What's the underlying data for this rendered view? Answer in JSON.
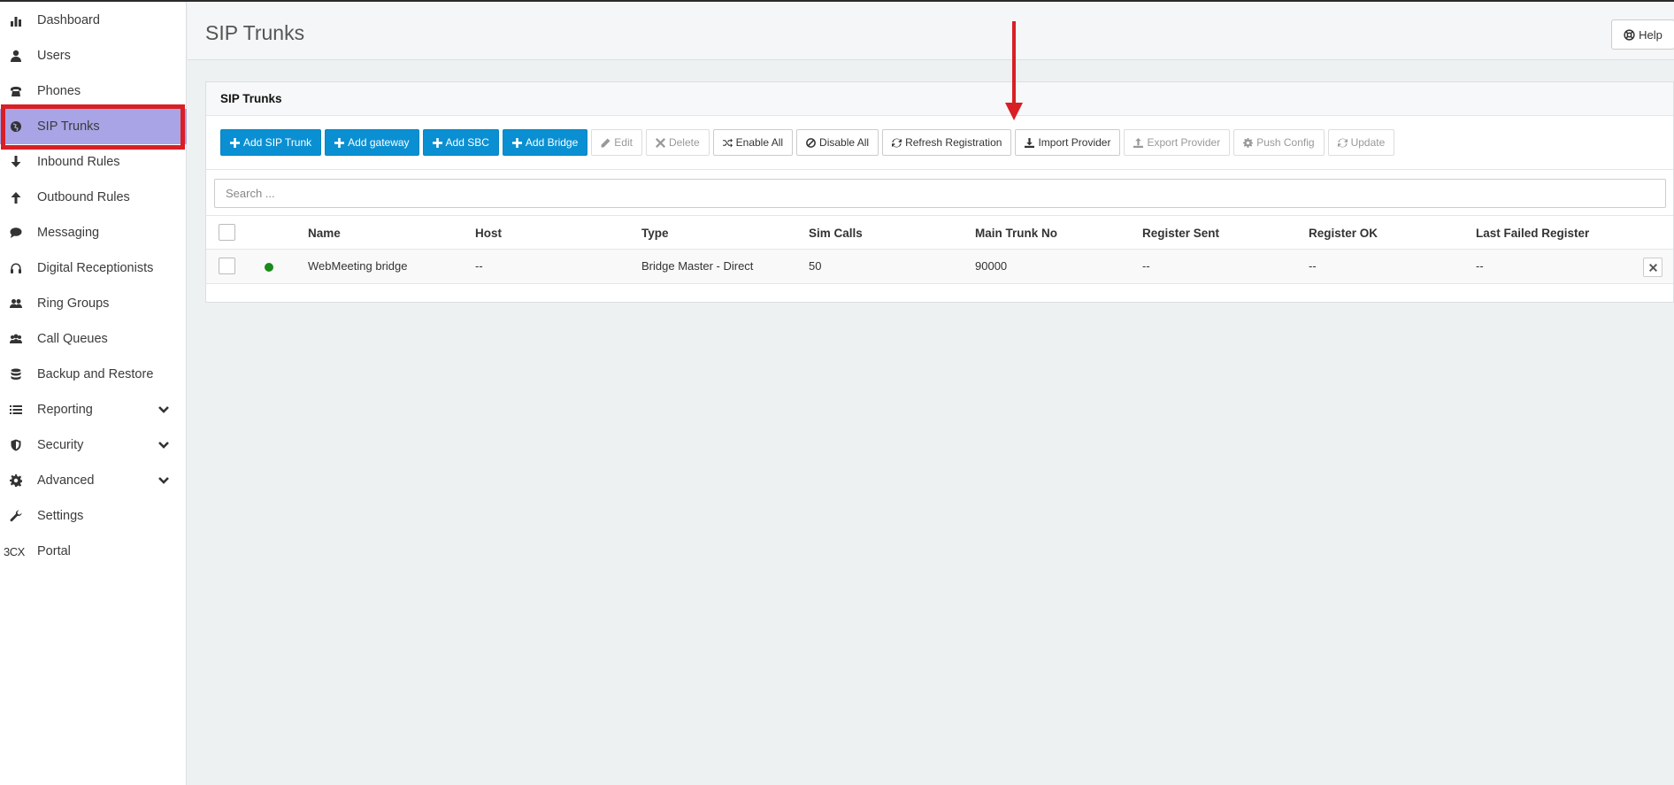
{
  "sidebar": {
    "items": [
      {
        "label": "Dashboard",
        "icon": "bar-chart-icon"
      },
      {
        "label": "Users",
        "icon": "user-icon"
      },
      {
        "label": "Phones",
        "icon": "phone-icon"
      },
      {
        "label": "SIP Trunks",
        "icon": "globe-icon",
        "active": true
      },
      {
        "label": "Inbound Rules",
        "icon": "arrow-down-icon"
      },
      {
        "label": "Outbound Rules",
        "icon": "arrow-up-icon"
      },
      {
        "label": "Messaging",
        "icon": "chat-bubble-icon"
      },
      {
        "label": "Digital Receptionists",
        "icon": "headset-icon"
      },
      {
        "label": "Ring Groups",
        "icon": "users-icon"
      },
      {
        "label": "Call Queues",
        "icon": "group-icon"
      },
      {
        "label": "Backup and Restore",
        "icon": "database-icon"
      },
      {
        "label": "Reporting",
        "icon": "list-icon",
        "expandable": true
      },
      {
        "label": "Security",
        "icon": "shield-icon",
        "expandable": true
      },
      {
        "label": "Advanced",
        "icon": "gear-icon",
        "expandable": true
      },
      {
        "label": "Settings",
        "icon": "wrench-icon"
      },
      {
        "label": "Portal",
        "icon": "3cx-logo",
        "logo_text": "3CX"
      }
    ]
  },
  "header": {
    "title": "SIP Trunks",
    "help_label": "Help"
  },
  "panel": {
    "title": "SIP Trunks",
    "toolbar": {
      "add_sip_trunk": "Add SIP Trunk",
      "add_gateway": "Add gateway",
      "add_sbc": "Add SBC",
      "add_bridge": "Add Bridge",
      "edit": "Edit",
      "delete": "Delete",
      "enable_all": "Enable All",
      "disable_all": "Disable All",
      "refresh_registration": "Refresh Registration",
      "import_provider": "Import Provider",
      "export_provider": "Export Provider",
      "push_config": "Push Config",
      "update": "Update"
    },
    "search": {
      "placeholder": "Search ...",
      "value": ""
    },
    "table": {
      "columns": [
        "Name",
        "Host",
        "Type",
        "Sim Calls",
        "Main Trunk No",
        "Register Sent",
        "Register OK",
        "Last Failed Register"
      ],
      "rows": [
        {
          "status_color": "#1a8a1a",
          "name": "WebMeeting bridge",
          "host": "--",
          "type": "Bridge Master - Direct",
          "sim_calls": "50",
          "main_trunk_no": "90000",
          "register_sent": "--",
          "register_ok": "--",
          "last_failed_register": "--"
        }
      ]
    }
  },
  "colors": {
    "primary": "#0a90d2",
    "active_nav": "#a8a4e6",
    "highlight_frame": "#d81f26",
    "annotation_arrow": "#d81f26"
  }
}
